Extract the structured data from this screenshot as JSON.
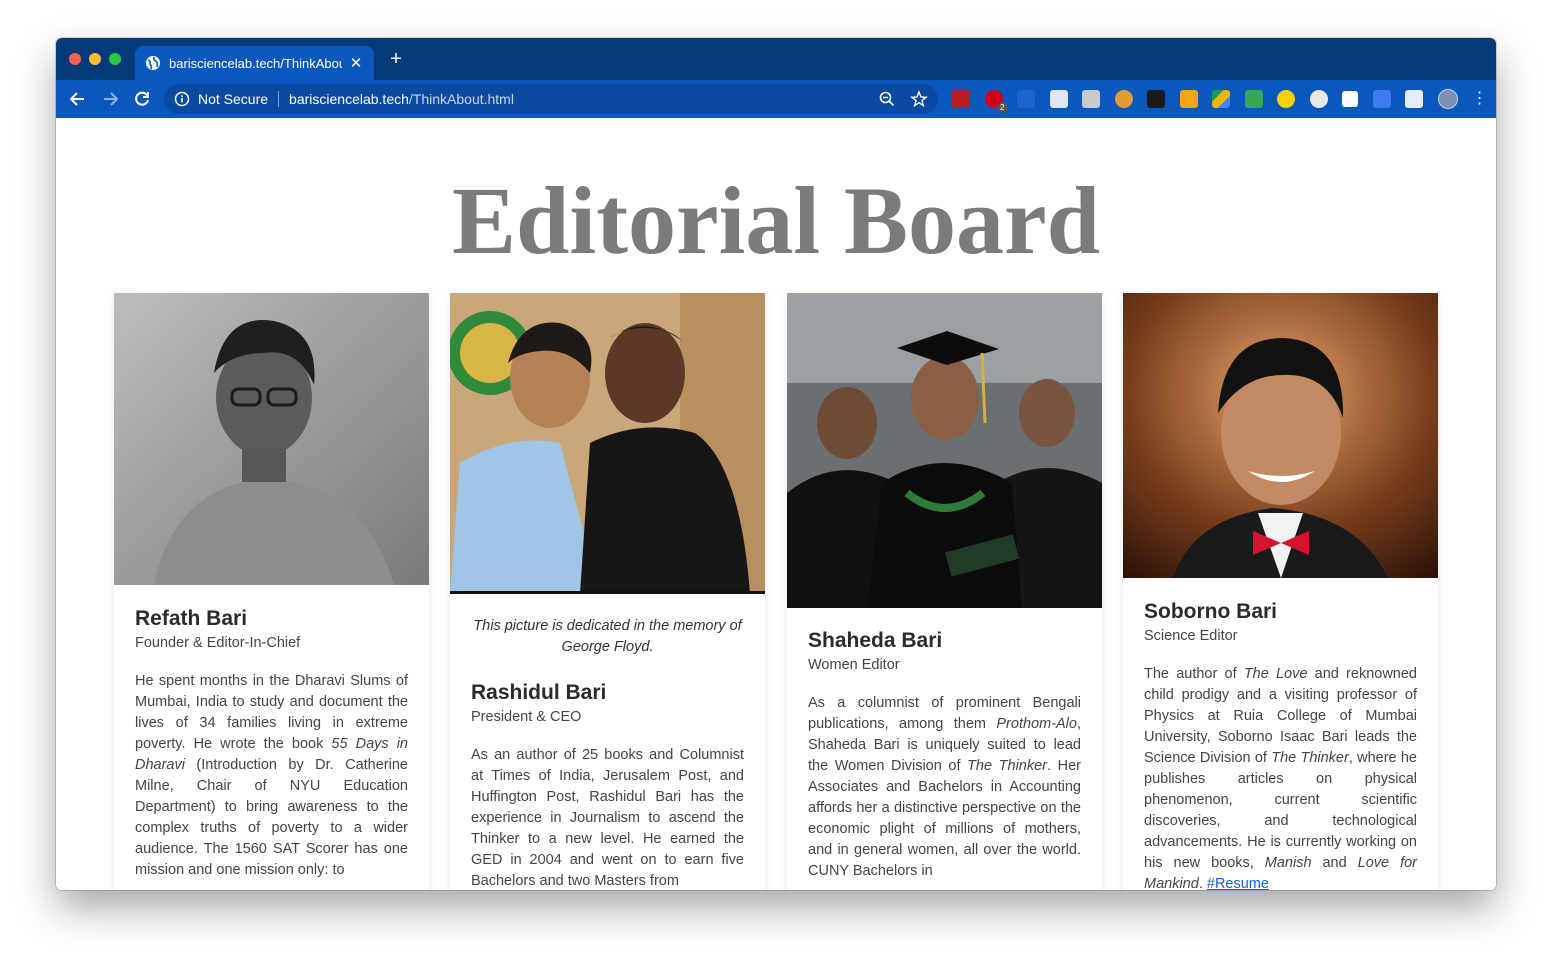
{
  "browser": {
    "tab_title": "barisciencelab.tech/ThinkAbout.html",
    "security_label": "Not Secure",
    "url_host": "barisciencelab.tech",
    "url_path": "/ThinkAbout.html",
    "extension_badge": "2",
    "accent_color": "#0a58bd",
    "tabbar_color": "#043a7a"
  },
  "page": {
    "title": "Editorial Board",
    "title_color": "#7b7b7b"
  },
  "members": [
    {
      "name": "Refath Bari",
      "role": "Founder & Editor-In-Chief",
      "bio": [
        {
          "t": "He spent months in the Dharavi Slums of Mumbai, India to study and document the lives of 34 families living in extreme poverty. He wrote the book "
        },
        {
          "t": "55 Days in Dharavi",
          "i": true
        },
        {
          "t": " (Introduction by Dr. Catherine Milne, Chair of NYU Education Department) to bring awareness to the complex truths of poverty to a wider audience. The 1560 SAT Scorer has one mission and one mission only: to"
        }
      ]
    },
    {
      "name": "Rashidul Bari",
      "role": "President & CEO",
      "caption": "This picture is dedicated in the memory of George Floyd.",
      "bio": [
        {
          "t": "As an author of 25 books and Columnist at Times of India, Jerusalem Post, and Huffington Post, Rashidul Bari has the experience in Journalism to ascend the Thinker to a new level. He earned the GED in 2004 and went on to earn five Bachelors and two Masters from"
        }
      ]
    },
    {
      "name": "Shaheda Bari",
      "role": "Women Editor",
      "bio": [
        {
          "t": "As a columnist of prominent Bengali publications, among them "
        },
        {
          "t": "Prothom-Alo",
          "i": true
        },
        {
          "t": ", Shaheda Bari is uniquely suited to lead the Women Division of "
        },
        {
          "t": "The Thinker",
          "i": true
        },
        {
          "t": ". Her Associates and Bachelors in Accounting affords her a distinctive perspective on the economic plight of millions of mothers, and in general women, all over the world. CUNY Bachelors in"
        }
      ]
    },
    {
      "name": "Soborno Bari",
      "role": "Science Editor",
      "bio": [
        {
          "t": "The author of "
        },
        {
          "t": "The Love",
          "i": true
        },
        {
          "t": " and reknowned child prodigy and a visiting professor of Physics at Ruia College of Mumbai University, Soborno Isaac Bari leads the Science Division of "
        },
        {
          "t": "The Thinker",
          "i": true
        },
        {
          "t": ", where he publishes articles on physical phenomenon, current scientific discoveries, and technological advancements. He is currently working on his new books, "
        },
        {
          "t": "Manish",
          "i": true
        },
        {
          "t": " and "
        },
        {
          "t": "Love for Mankind",
          "i": true
        },
        {
          "t": ". "
        },
        {
          "t": "#Resume",
          "link": true
        }
      ]
    }
  ]
}
